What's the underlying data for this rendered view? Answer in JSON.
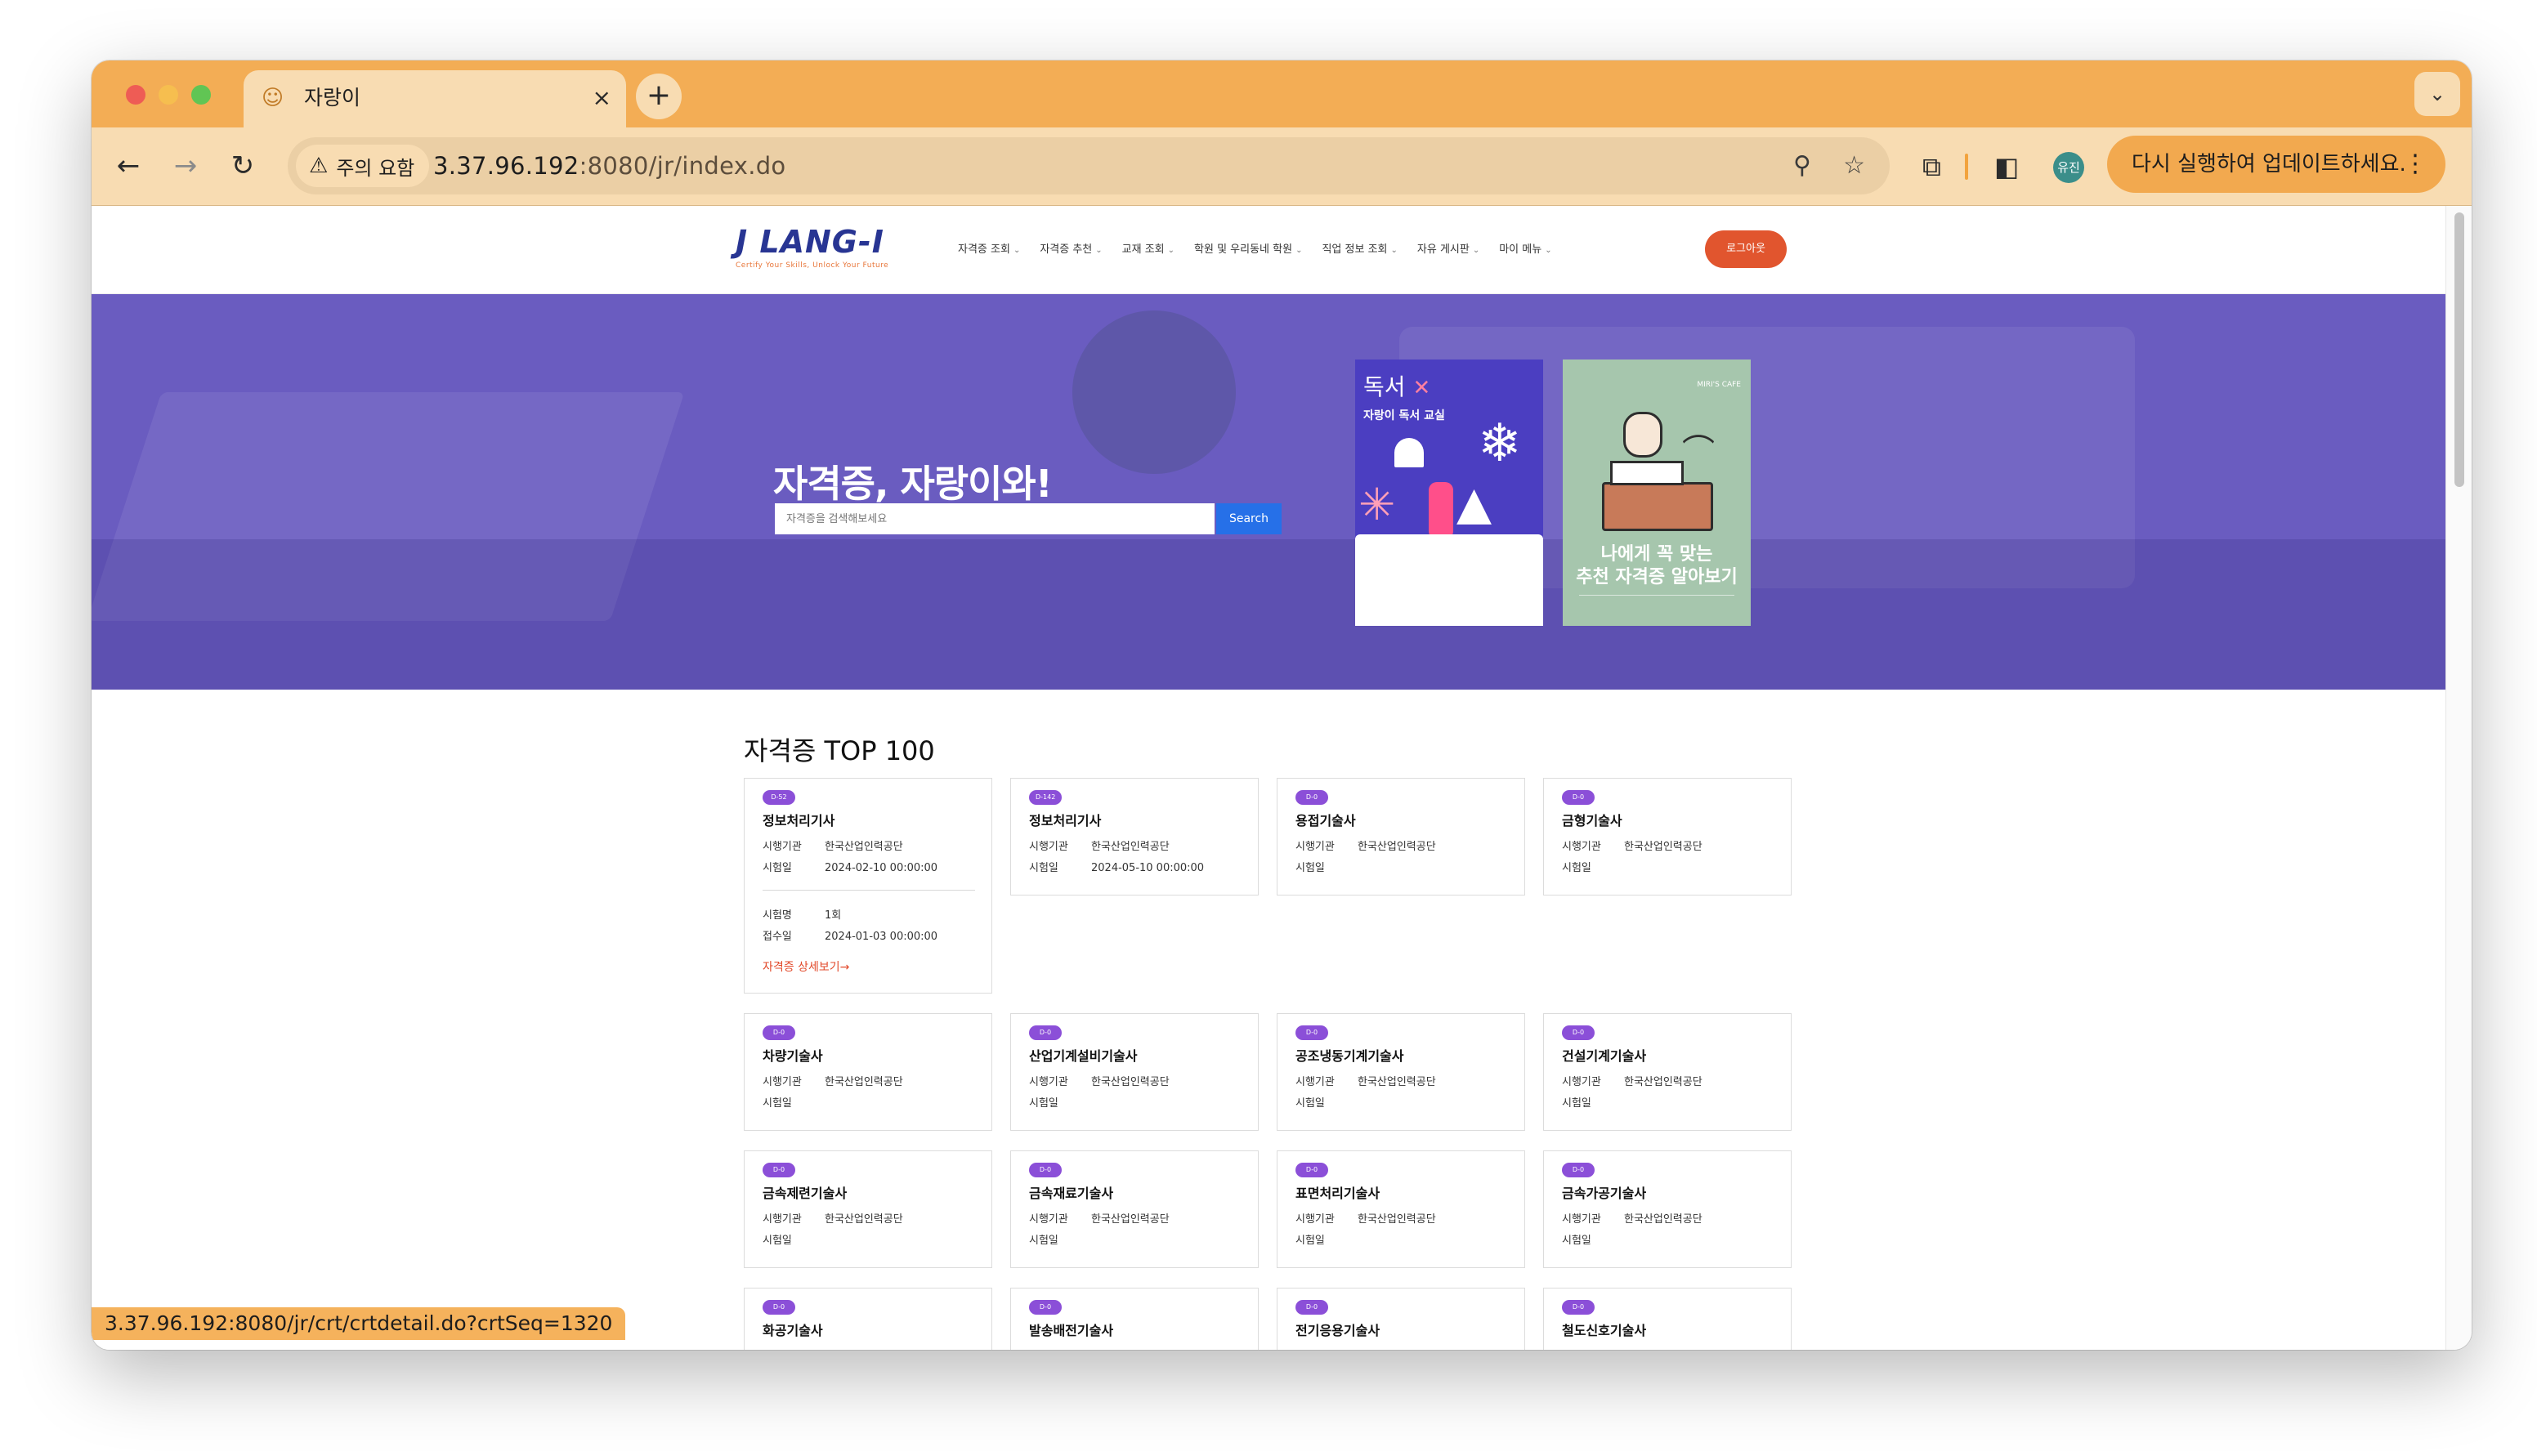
{
  "browser": {
    "tab_title": "자랑이",
    "tab_close": "×",
    "new_tab": "+",
    "tab_menu": "⌄",
    "security_chip": "주의 요함",
    "url_host": "3.37.96.192",
    "url_path": ":8080/jr/index.do",
    "profile_initials": "유진",
    "update_label": "다시 실행하여 업데이트하세요.",
    "kebab": "⋮",
    "status_url": "3.37.96.192:8080/jr/crt/crtdetail.do?crtSeq=1320",
    "accent_color": "#f3ad55"
  },
  "site": {
    "logo_main": "J LANG-I",
    "logo_tagline": "Certify Your Skills, Unlock Your Future",
    "nav": [
      "자격증 조회",
      "자격증 추천",
      "교재 조회",
      "학원 및 우리동네 학원",
      "직업 정보 조회",
      "자유 게시판",
      "마이 메뉴"
    ],
    "logout_label": "로그아웃",
    "hero_title": "자격증, 자랑이와!",
    "search_placeholder": "자격증을 검색해보세요",
    "search_button": "Search",
    "poster1_title": "독서",
    "poster1_subtitle": "자랑이 독서 교실",
    "poster2_brand": "MIRI'S CAFE",
    "poster2_line1": "나에게 꼭 맞는",
    "poster2_line2": "추천 자격증 알아보기",
    "hero_color": "#6a5cc0"
  },
  "section": {
    "title": "자격증 TOP 100",
    "label_agency": "시행기관",
    "label_date": "시험일",
    "label_round": "시험명",
    "label_receipt": "접수일",
    "detail_link": "자격증 상세보기→",
    "cards": [
      {
        "badge": "D-52",
        "name": "정보처리기사",
        "agency": "한국산업인력공단",
        "date": "2024-02-10 00:00:00",
        "round": "1회",
        "receipt": "2024-01-03 00:00:00"
      },
      {
        "badge": "D-142",
        "name": "정보처리기사",
        "agency": "한국산업인력공단",
        "date": "2024-05-10 00:00:00"
      },
      {
        "badge": "D-0",
        "name": "용접기술사",
        "agency": "한국산업인력공단",
        "date": ""
      },
      {
        "badge": "D-0",
        "name": "금형기술사",
        "agency": "한국산업인력공단",
        "date": ""
      },
      {
        "badge": "D-0",
        "name": "차량기술사",
        "agency": "한국산업인력공단",
        "date": ""
      },
      {
        "badge": "D-0",
        "name": "산업기계설비기술사",
        "agency": "한국산업인력공단",
        "date": ""
      },
      {
        "badge": "D-0",
        "name": "공조냉동기계기술사",
        "agency": "한국산업인력공단",
        "date": ""
      },
      {
        "badge": "D-0",
        "name": "건설기계기술사",
        "agency": "한국산업인력공단",
        "date": ""
      },
      {
        "badge": "D-0",
        "name": "금속제련기술사",
        "agency": "한국산업인력공단",
        "date": ""
      },
      {
        "badge": "D-0",
        "name": "금속재료기술사",
        "agency": "한국산업인력공단",
        "date": ""
      },
      {
        "badge": "D-0",
        "name": "표면처리기술사",
        "agency": "한국산업인력공단",
        "date": ""
      },
      {
        "badge": "D-0",
        "name": "금속가공기술사",
        "agency": "한국산업인력공단",
        "date": ""
      },
      {
        "badge": "D-0",
        "name": "화공기술사"
      },
      {
        "badge": "D-0",
        "name": "발송배전기술사"
      },
      {
        "badge": "D-0",
        "name": "전기응용기술사"
      },
      {
        "badge": "D-0",
        "name": "철도신호기술사"
      }
    ]
  }
}
